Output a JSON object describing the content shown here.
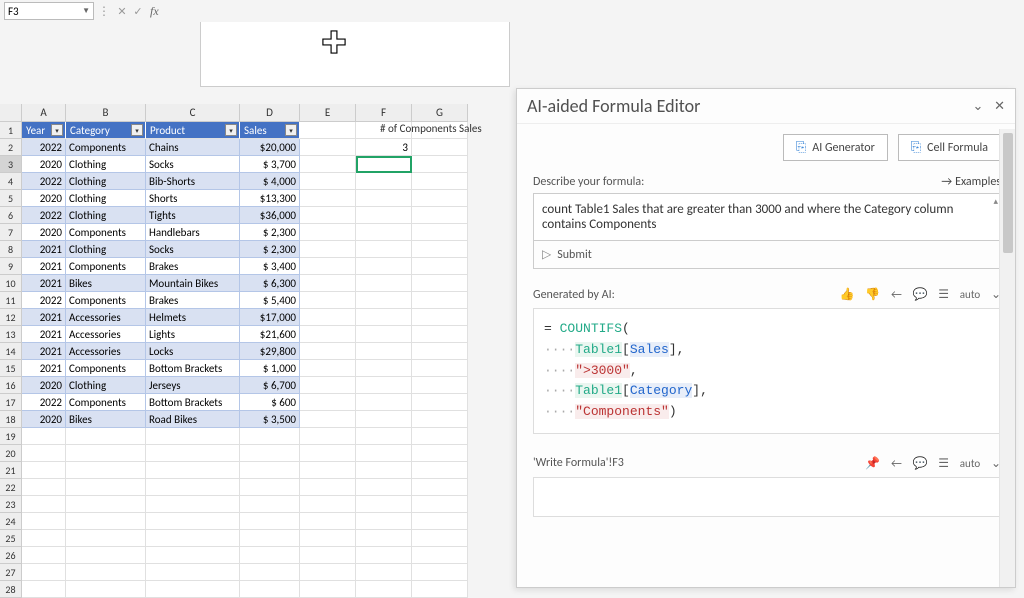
{
  "name_box": "F3",
  "formula_label": "fx",
  "cursor_type": "plus",
  "columns": [
    "A",
    "B",
    "C",
    "D",
    "E",
    "F",
    "G"
  ],
  "table": {
    "headers": [
      "Year",
      "Category",
      "Product",
      "Sales"
    ],
    "rows": [
      {
        "year": "2022",
        "cat": "Components",
        "prod": "Chains",
        "sales": "$20,000"
      },
      {
        "year": "2020",
        "cat": "Clothing",
        "prod": "Socks",
        "sales": "$  3,700"
      },
      {
        "year": "2022",
        "cat": "Clothing",
        "prod": "Bib-Shorts",
        "sales": "$  4,000"
      },
      {
        "year": "2020",
        "cat": "Clothing",
        "prod": "Shorts",
        "sales": "$13,300"
      },
      {
        "year": "2022",
        "cat": "Clothing",
        "prod": "Tights",
        "sales": "$36,000"
      },
      {
        "year": "2020",
        "cat": "Components",
        "prod": "Handlebars",
        "sales": "$  2,300"
      },
      {
        "year": "2021",
        "cat": "Clothing",
        "prod": "Socks",
        "sales": "$  2,300"
      },
      {
        "year": "2021",
        "cat": "Components",
        "prod": "Brakes",
        "sales": "$  3,400"
      },
      {
        "year": "2021",
        "cat": "Bikes",
        "prod": "Mountain Bikes",
        "sales": "$  6,300"
      },
      {
        "year": "2022",
        "cat": "Components",
        "prod": "Brakes",
        "sales": "$  5,400"
      },
      {
        "year": "2021",
        "cat": "Accessories",
        "prod": "Helmets",
        "sales": "$17,000"
      },
      {
        "year": "2021",
        "cat": "Accessories",
        "prod": "Lights",
        "sales": "$21,600"
      },
      {
        "year": "2021",
        "cat": "Accessories",
        "prod": "Locks",
        "sales": "$29,800"
      },
      {
        "year": "2021",
        "cat": "Components",
        "prod": "Bottom Brackets",
        "sales": "$  1,000"
      },
      {
        "year": "2020",
        "cat": "Clothing",
        "prod": "Jerseys",
        "sales": "$  6,700"
      },
      {
        "year": "2022",
        "cat": "Components",
        "prod": "Bottom Brackets",
        "sales": "$     600"
      },
      {
        "year": "2020",
        "cat": "Bikes",
        "prod": "Road Bikes",
        "sales": "$  3,500"
      }
    ]
  },
  "extra_cells": {
    "F1_label": "# of Components Sales",
    "F2_value": "3"
  },
  "panel": {
    "title": "AI-aided Formula Editor",
    "btn_ai": "AI Generator",
    "btn_cell": "Cell Formula",
    "describe_label": "Describe your formula:",
    "examples": "Examples",
    "description": "count Table1 Sales that are greater than 3000 and where the Category column contains Components",
    "submit": "Submit",
    "generated_label": "Generated by AI:",
    "auto_label": "auto",
    "formula": {
      "fn": "COUNTIFS",
      "arg1_tbl": "Table1",
      "arg1_col": "Sales",
      "arg2": "\">3000\"",
      "arg3_tbl": "Table1",
      "arg3_col": "Category",
      "arg4": "\"Components\""
    },
    "ref_label": "'Write Formula'!F3"
  }
}
